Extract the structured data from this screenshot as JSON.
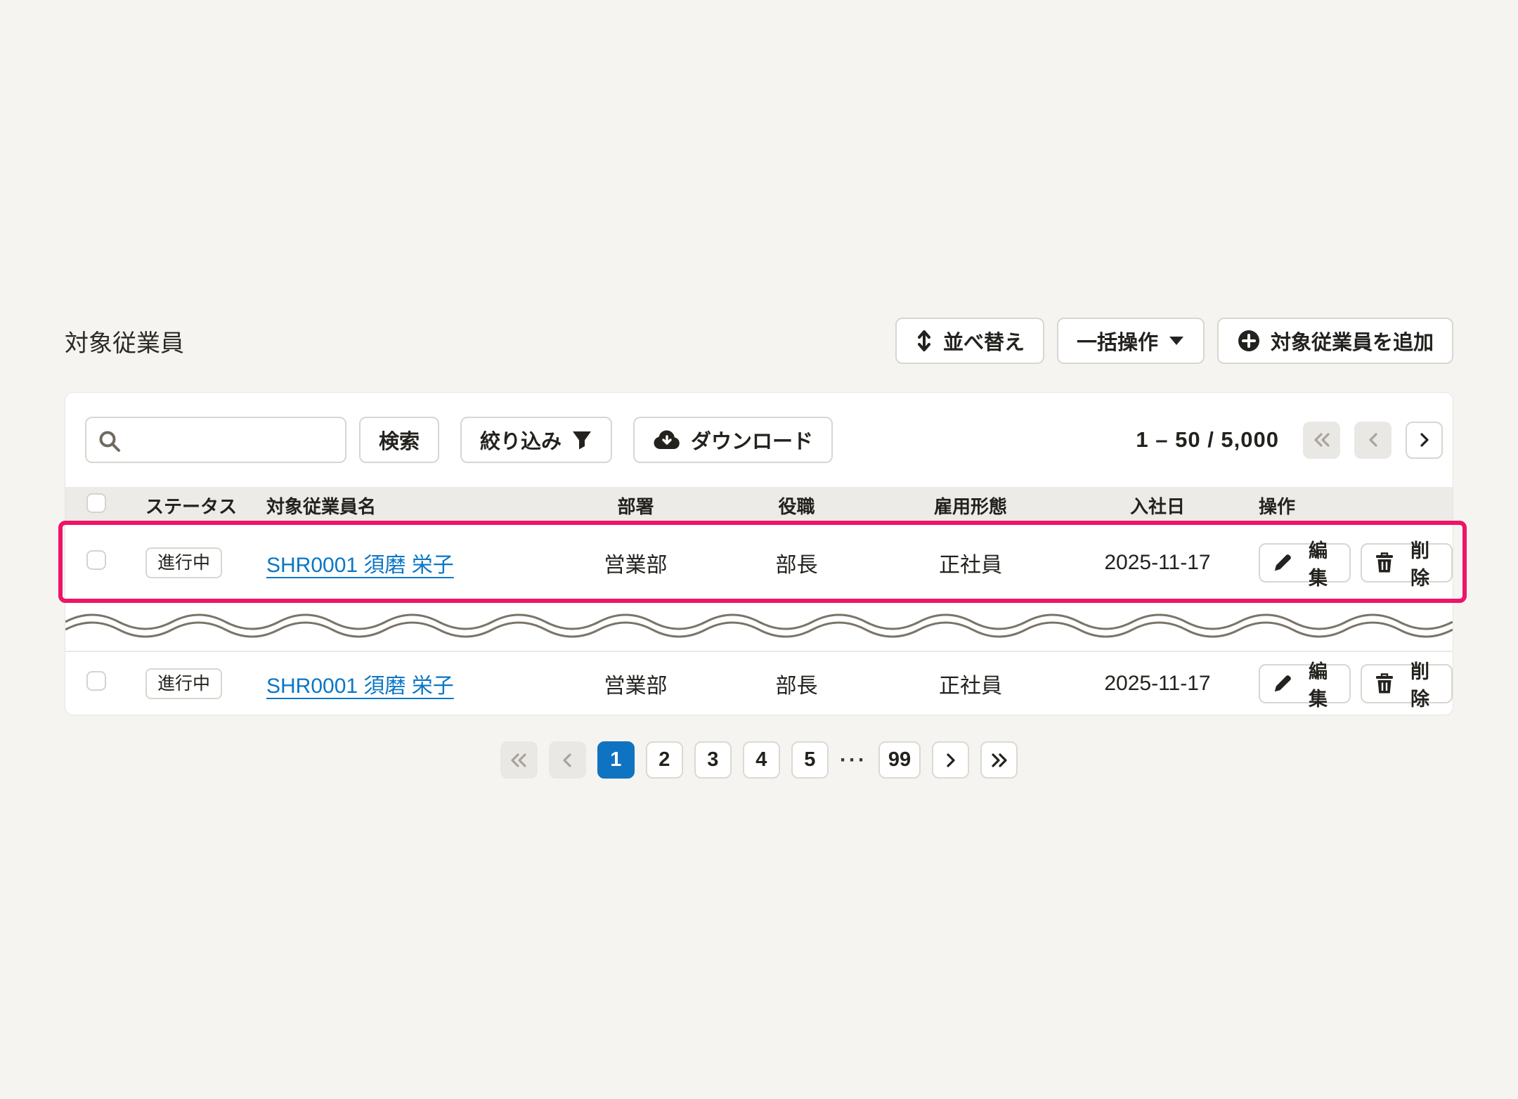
{
  "page_title": "対象従業員",
  "header_actions": {
    "sort_label": "並べ替え",
    "bulk_label": "一括操作",
    "add_label": "対象従業員を追加"
  },
  "toolbar": {
    "search_value": "",
    "search_placeholder": "",
    "search_button": "検索",
    "filter_button": "絞り込み",
    "download_button": "ダウンロード",
    "range_text": "1 – 50 / 5,000"
  },
  "table": {
    "columns": [
      "ステータス",
      "対象従業員名",
      "部署",
      "役職",
      "雇用形態",
      "入社日",
      "操作"
    ],
    "rows": [
      {
        "status": "進行中",
        "name": "SHR0001 須磨 栄子",
        "department": "営業部",
        "position": "部長",
        "employment_type": "正社員",
        "hire_date": "2025-11-17",
        "edit_label": "編集",
        "delete_label": "削除",
        "checked": false
      },
      {
        "status": "進行中",
        "name": "SHR0001 須磨 栄子",
        "department": "営業部",
        "position": "部長",
        "employment_type": "正社員",
        "hire_date": "2025-11-17",
        "edit_label": "編集",
        "delete_label": "削除",
        "checked": false
      }
    ],
    "select_all_checked": false
  },
  "pagination": {
    "pages": [
      "1",
      "2",
      "3",
      "4",
      "5"
    ],
    "active_page": "1",
    "ellipsis": "···",
    "last_page": "99"
  },
  "icons": {
    "sort": "↕",
    "caret_down": "▼",
    "plus_circle": "⊕",
    "search": "⌕",
    "filter_funnel": "▼",
    "cloud_download": "☁↓",
    "pencil": "✎",
    "trash": "🗑",
    "chevron_left": "‹",
    "chevron_right": "›",
    "chevrons_left": "«",
    "chevrons_right": "»"
  },
  "colors": {
    "page_background": "#f5f4f1",
    "card_background": "#ffffff",
    "table_header_background": "#edebe7",
    "border_gray": "#d9d6d0",
    "text_primary": "#23221e",
    "link_blue": "#0b76c6",
    "active_page_blue": "#0f73c2",
    "highlight_pink": "#ee1466",
    "disabled_background": "#eae8e4",
    "disabled_foreground": "#a8a49c",
    "wave_gray": "#7a7468"
  }
}
